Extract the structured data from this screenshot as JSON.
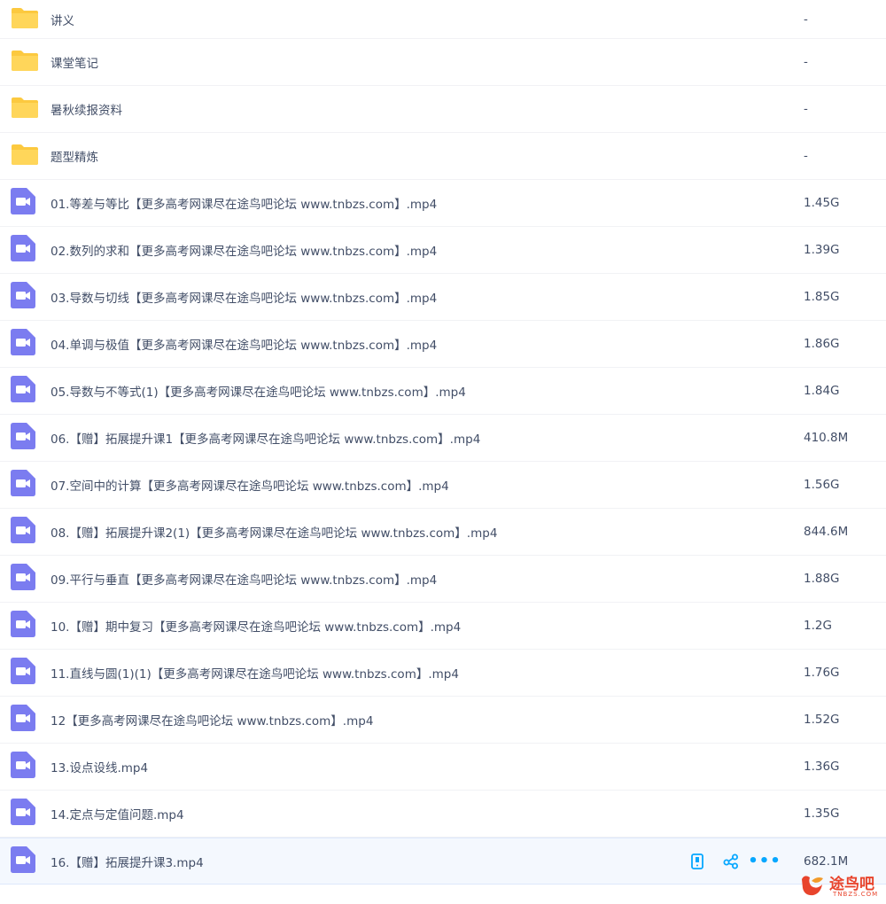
{
  "files": [
    {
      "name": "讲义",
      "size": "-",
      "type": "folder"
    },
    {
      "name": "课堂笔记",
      "size": "-",
      "type": "folder"
    },
    {
      "name": "暑秋续报资料",
      "size": "-",
      "type": "folder"
    },
    {
      "name": "题型精炼",
      "size": "-",
      "type": "folder"
    },
    {
      "name": "01.等差与等比【更多高考网课尽在途鸟吧论坛 www.tnbzs.com】.mp4",
      "size": "1.45G",
      "type": "video"
    },
    {
      "name": "02.数列的求和【更多高考网课尽在途鸟吧论坛 www.tnbzs.com】.mp4",
      "size": "1.39G",
      "type": "video"
    },
    {
      "name": "03.导数与切线【更多高考网课尽在途鸟吧论坛 www.tnbzs.com】.mp4",
      "size": "1.85G",
      "type": "video"
    },
    {
      "name": "04.单调与极值【更多高考网课尽在途鸟吧论坛 www.tnbzs.com】.mp4",
      "size": "1.86G",
      "type": "video"
    },
    {
      "name": "05.导数与不等式(1)【更多高考网课尽在途鸟吧论坛 www.tnbzs.com】.mp4",
      "size": "1.84G",
      "type": "video"
    },
    {
      "name": "06.【赠】拓展提升课1【更多高考网课尽在途鸟吧论坛 www.tnbzs.com】.mp4",
      "size": "410.8M",
      "type": "video"
    },
    {
      "name": "07.空间中的计算【更多高考网课尽在途鸟吧论坛 www.tnbzs.com】.mp4",
      "size": "1.56G",
      "type": "video"
    },
    {
      "name": "08.【赠】拓展提升课2(1)【更多高考网课尽在途鸟吧论坛 www.tnbzs.com】.mp4",
      "size": "844.6M",
      "type": "video"
    },
    {
      "name": "09.平行与垂直【更多高考网课尽在途鸟吧论坛 www.tnbzs.com】.mp4",
      "size": "1.88G",
      "type": "video"
    },
    {
      "name": "10.【赠】期中复习【更多高考网课尽在途鸟吧论坛 www.tnbzs.com】.mp4",
      "size": "1.2G",
      "type": "video"
    },
    {
      "name": "11.直线与圆(1)(1)【更多高考网课尽在途鸟吧论坛 www.tnbzs.com】.mp4",
      "size": "1.76G",
      "type": "video"
    },
    {
      "name": "12【更多高考网课尽在途鸟吧论坛 www.tnbzs.com】.mp4",
      "size": "1.52G",
      "type": "video"
    },
    {
      "name": "13.设点设线.mp4",
      "size": "1.36G",
      "type": "video"
    },
    {
      "name": "14.定点与定值问题.mp4",
      "size": "1.35G",
      "type": "video"
    },
    {
      "name": "16.【赠】拓展提升课3.mp4",
      "size": "682.1M",
      "type": "video",
      "selected": true
    }
  ],
  "row_actions": {
    "icons": [
      "phone-icon",
      "share-icon",
      "more-icon"
    ],
    "more_label": "•••"
  },
  "watermark": {
    "text": "途鸟吧",
    "sub": "TNBZS.COM"
  },
  "colors": {
    "folder": "#fcc93f",
    "video": "#7b7cf0",
    "action": "#06a7ff",
    "selected_bg": "#f4f8fe",
    "text": "#424e67"
  }
}
